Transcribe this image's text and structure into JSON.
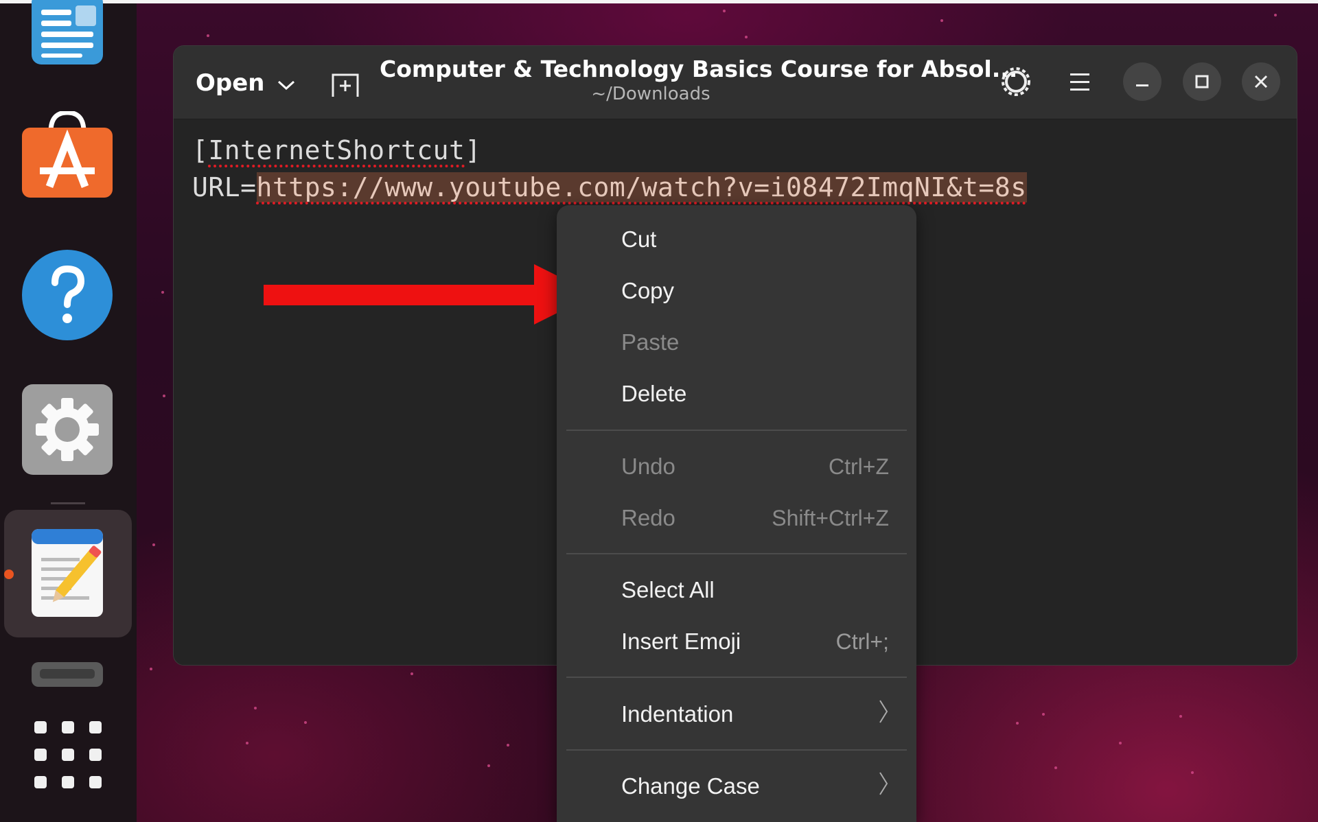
{
  "window": {
    "open_label": "Open",
    "title": "Computer & Technology Basics Course for Absol...",
    "subtitle": "~/Downloads"
  },
  "editor": {
    "line1": "[InternetShortcut]",
    "line2_prefix": "URL=",
    "line2_url": "https://www.youtube.com/watch?v=i08472ImqNI&t=8s"
  },
  "context_menu": {
    "items": [
      {
        "label": "Cut",
        "accel": "",
        "enabled": true
      },
      {
        "label": "Copy",
        "accel": "",
        "enabled": true
      },
      {
        "label": "Paste",
        "accel": "",
        "enabled": false
      },
      {
        "label": "Delete",
        "accel": "",
        "enabled": true
      },
      {
        "label": "Undo",
        "accel": "Ctrl+Z",
        "enabled": false
      },
      {
        "label": "Redo",
        "accel": "Shift+Ctrl+Z",
        "enabled": false
      },
      {
        "label": "Select All",
        "accel": "",
        "enabled": true
      },
      {
        "label": "Insert Emoji",
        "accel": "Ctrl+;",
        "enabled": true
      },
      {
        "label": "Indentation",
        "accel": "",
        "enabled": true,
        "submenu": true
      },
      {
        "label": "Change Case",
        "accel": "",
        "enabled": true,
        "submenu": true
      }
    ]
  },
  "dock": {
    "apps": [
      "document-viewer-icon",
      "app-center-icon",
      "help-icon",
      "settings-icon",
      "text-editor-icon",
      "removable-drive-icon",
      "show-apps-grid-icon"
    ],
    "active_app": "text-editor-icon",
    "accent_color": "#e95420"
  },
  "annotation": {
    "arrow_color": "#ee1111"
  }
}
